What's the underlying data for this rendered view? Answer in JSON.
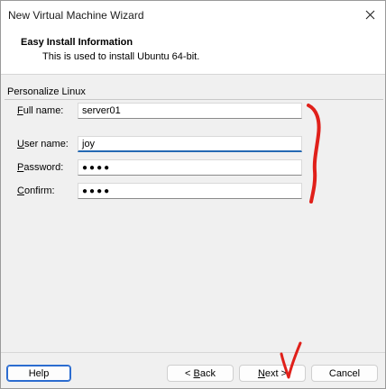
{
  "window": {
    "title": "New Virtual Machine Wizard"
  },
  "header": {
    "title": "Easy Install Information",
    "subtitle": "This is used to install Ubuntu 64-bit."
  },
  "section": {
    "label": "Personalize Linux"
  },
  "fields": {
    "full_name": {
      "label_mnemonic": "F",
      "label_rest": "ull name:",
      "value": "server01"
    },
    "user_name": {
      "label_mnemonic": "U",
      "label_rest": "ser name:",
      "value": "joy"
    },
    "password": {
      "label_mnemonic": "P",
      "label_rest": "assword:",
      "value": "●●●●"
    },
    "confirm": {
      "label_mnemonic": "C",
      "label_rest": "onfirm:",
      "value": "●●●●"
    }
  },
  "buttons": {
    "help": "Help",
    "back_prefix": "< ",
    "back_mnemonic": "B",
    "back_rest": "ack",
    "next_mnemonic": "N",
    "next_rest": "ext >",
    "cancel": "Cancel"
  },
  "colors": {
    "annotation_red": "#e0201a",
    "accent_blue": "#2b6cd0"
  },
  "icons": {
    "close": "close-icon"
  }
}
